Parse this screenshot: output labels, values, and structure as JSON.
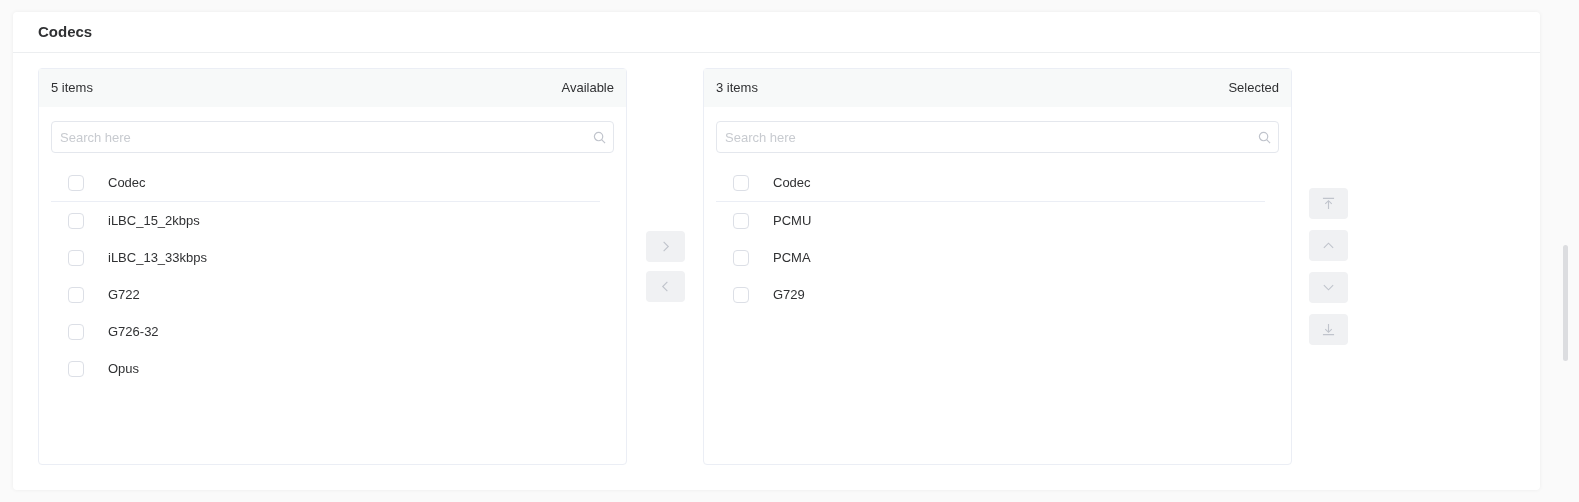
{
  "section": {
    "title": "Codecs"
  },
  "lists": [
    {
      "count": "5 items",
      "label": "Available",
      "search": {
        "placeholder": "Search here"
      },
      "header": {
        "label": "Codec",
        "checked": false
      },
      "items": [
        {
          "label": "iLBC_15_2kbps",
          "checked": false
        },
        {
          "label": "iLBC_13_33kbps",
          "checked": false
        },
        {
          "label": "G722",
          "checked": false
        },
        {
          "label": "G726-32",
          "checked": false
        },
        {
          "label": "Opus",
          "checked": false
        }
      ]
    },
    {
      "count": "3 items",
      "label": "Selected",
      "search": {
        "placeholder": "Search here"
      },
      "header": {
        "label": "Codec",
        "checked": false
      },
      "items": [
        {
          "label": "PCMU",
          "checked": false
        },
        {
          "label": "PCMA",
          "checked": false
        },
        {
          "label": "G729",
          "checked": false
        }
      ]
    }
  ],
  "transfer_buttons": [
    {
      "kind": "right",
      "disabled": true
    },
    {
      "kind": "left",
      "disabled": true
    }
  ],
  "order_buttons": [
    {
      "kind": "top",
      "disabled": true
    },
    {
      "kind": "up",
      "disabled": true
    },
    {
      "kind": "down",
      "disabled": true
    },
    {
      "kind": "bottom",
      "disabled": true
    }
  ]
}
